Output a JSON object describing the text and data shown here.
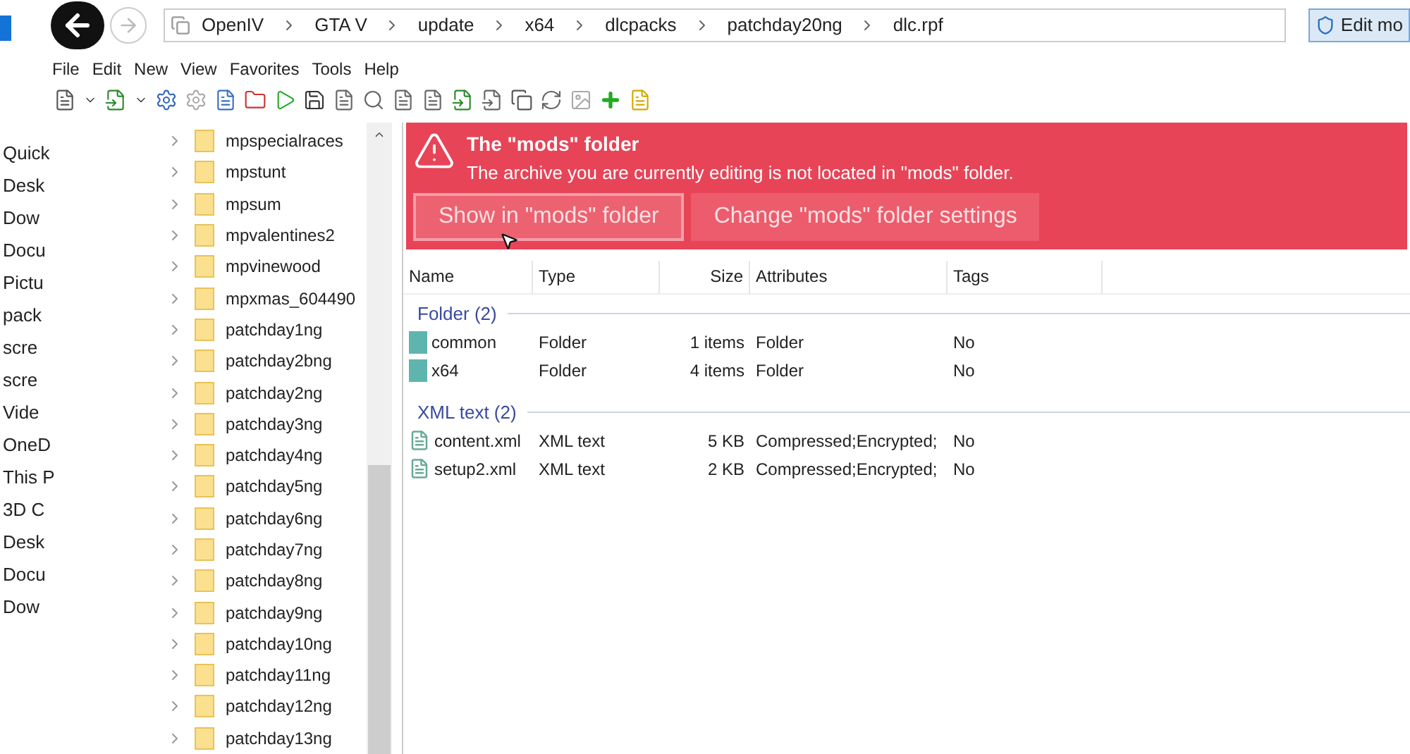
{
  "breadcrumb": [
    "OpenIV",
    "GTA V",
    "update",
    "x64",
    "dlcpacks",
    "patchday20ng",
    "dlc.rpf"
  ],
  "edit_button": "Edit mo",
  "menu": [
    "File",
    "Edit",
    "New",
    "View",
    "Favorites",
    "Tools",
    "Help"
  ],
  "nav_pane": [
    "Quick",
    "Desk",
    "Dow",
    "Docu",
    "Pictu",
    "pack",
    "scre",
    "scre",
    "Vide",
    "OneD",
    "This P",
    "3D C",
    "Desk",
    "Docu",
    "Dow"
  ],
  "tree": [
    "mpspecialraces",
    "mpstunt",
    "mpsum",
    "mpvalentines2",
    "mpvinewood",
    "mpxmas_604490",
    "patchday1ng",
    "patchday2bng",
    "patchday2ng",
    "patchday3ng",
    "patchday4ng",
    "patchday5ng",
    "patchday6ng",
    "patchday7ng",
    "patchday8ng",
    "patchday9ng",
    "patchday10ng",
    "patchday11ng",
    "patchday12ng",
    "patchday13ng"
  ],
  "banner": {
    "title": "The \"mods\" folder",
    "message": "The archive you are currently editing is not located in \"mods\" folder.",
    "buttons": [
      {
        "label": "Show in \"mods\" folder",
        "hovered": true
      },
      {
        "label": "Change \"mods\" folder settings",
        "hovered": false
      }
    ]
  },
  "table": {
    "columns": [
      "Name",
      "Type",
      "Size",
      "Attributes",
      "Tags"
    ],
    "groups": [
      {
        "title": "Folder (2)",
        "rows": [
          {
            "kind": "folder",
            "cells": [
              "common",
              "Folder",
              "1 items",
              "Folder",
              "No"
            ]
          },
          {
            "kind": "folder",
            "cells": [
              "x64",
              "Folder",
              "4 items",
              "Folder",
              "No"
            ]
          }
        ]
      },
      {
        "title": "XML text (2)",
        "rows": [
          {
            "kind": "xml",
            "cells": [
              "content.xml",
              "XML text",
              "5 KB",
              "Compressed;Encrypted;",
              "No"
            ]
          },
          {
            "kind": "xml",
            "cells": [
              "setup2.xml",
              "XML text",
              "2 KB",
              "Compressed;Encrypted;",
              "No"
            ]
          }
        ]
      }
    ]
  }
}
